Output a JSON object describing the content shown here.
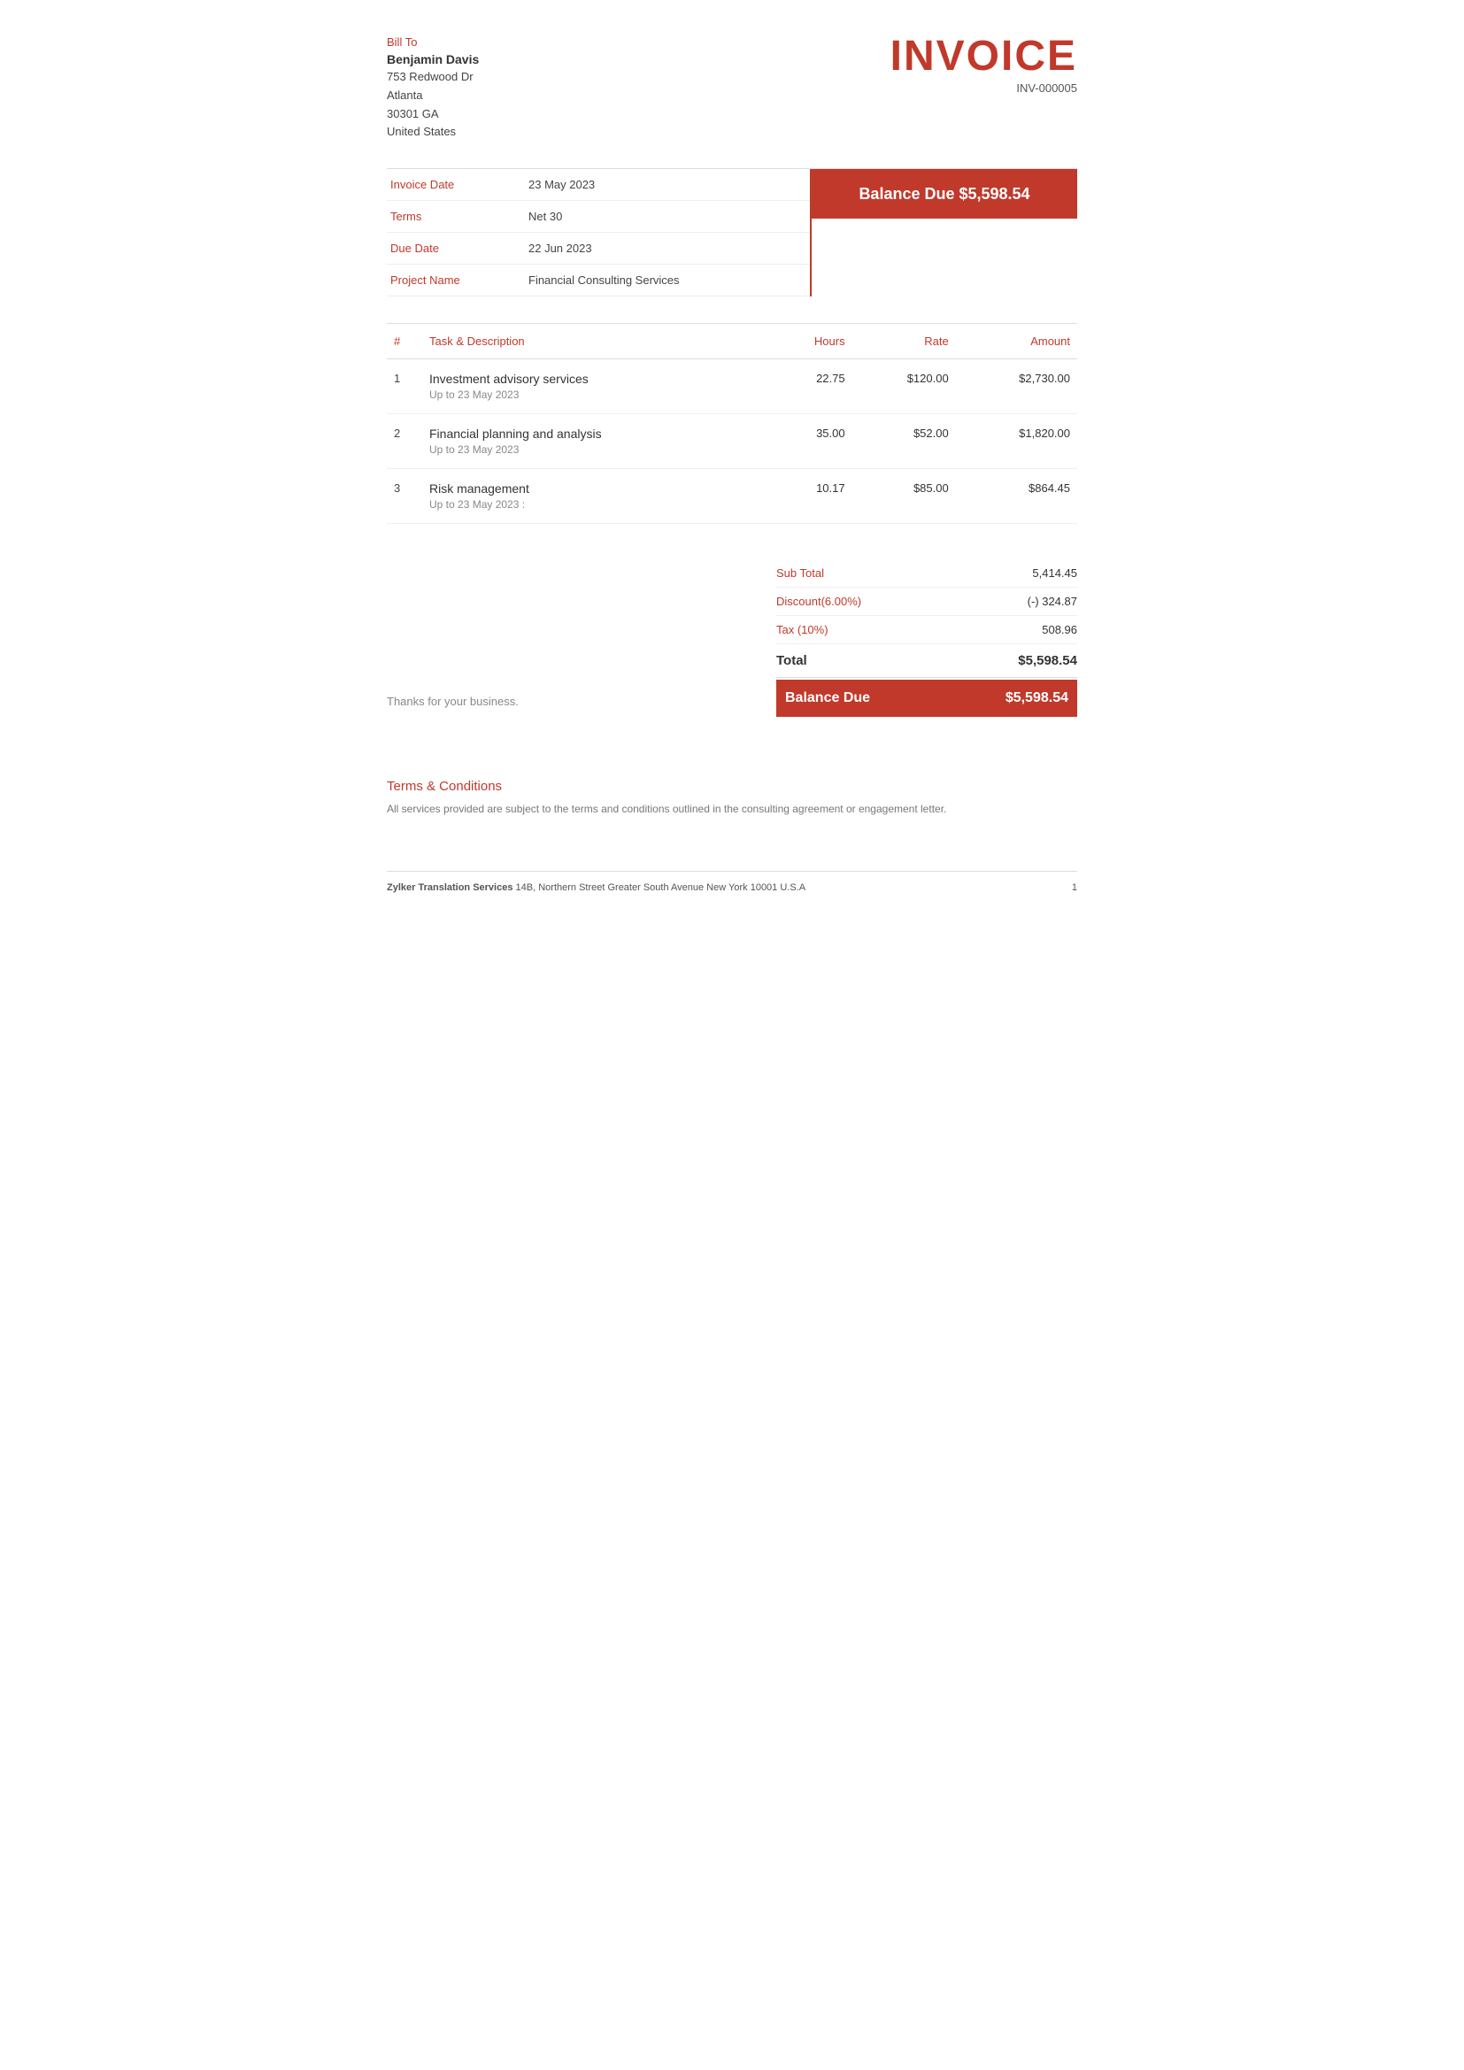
{
  "bill_to": {
    "label": "Bill To",
    "name": "Benjamin Davis",
    "address_line1": "753 Redwood Dr",
    "address_line2": "Atlanta",
    "address_line3": "30301 GA",
    "address_line4": "United States"
  },
  "invoice": {
    "title": "INVOICE",
    "number": "INV-000005"
  },
  "balance_due_header": "Balance Due $5,598.54",
  "info_rows": [
    {
      "label": "Invoice Date",
      "value": "23 May 2023"
    },
    {
      "label": "Terms",
      "value": "Net 30"
    },
    {
      "label": "Due Date",
      "value": "22 Jun 2023"
    },
    {
      "label": "Project Name",
      "value": "Financial Consulting Services"
    }
  ],
  "table": {
    "headers": {
      "num": "#",
      "task": "Task & Description",
      "hours": "Hours",
      "rate": "Rate",
      "amount": "Amount"
    },
    "rows": [
      {
        "num": "1",
        "task": "Investment advisory services",
        "sub": "Up to 23 May 2023",
        "hours": "22.75",
        "rate": "$120.00",
        "amount": "$2,730.00"
      },
      {
        "num": "2",
        "task": "Financial planning and analysis",
        "sub": "Up to 23 May 2023",
        "hours": "35.00",
        "rate": "$52.00",
        "amount": "$1,820.00"
      },
      {
        "num": "3",
        "task": "Risk management",
        "sub": "Up to 23 May 2023 :",
        "hours": "10.17",
        "rate": "$85.00",
        "amount": "$864.45"
      }
    ]
  },
  "thanks_text": "Thanks for your business.",
  "totals": {
    "sub_total_label": "Sub Total",
    "sub_total_value": "5,414.45",
    "discount_label": "Discount(6.00%)",
    "discount_value": "(-) 324.87",
    "tax_label": "Tax (10%)",
    "tax_value": "508.96",
    "total_label": "Total",
    "total_value": "$5,598.54",
    "balance_due_label": "Balance Due",
    "balance_due_value": "$5,598.54"
  },
  "terms": {
    "title": "Terms & Conditions",
    "text": "All services provided are subject to the terms and conditions outlined in the consulting agreement or engagement letter."
  },
  "footer": {
    "company": "Zylker Translation Services",
    "address": "14B, Northern Street Greater South Avenue New York 10001 U.S.A",
    "page": "1"
  }
}
